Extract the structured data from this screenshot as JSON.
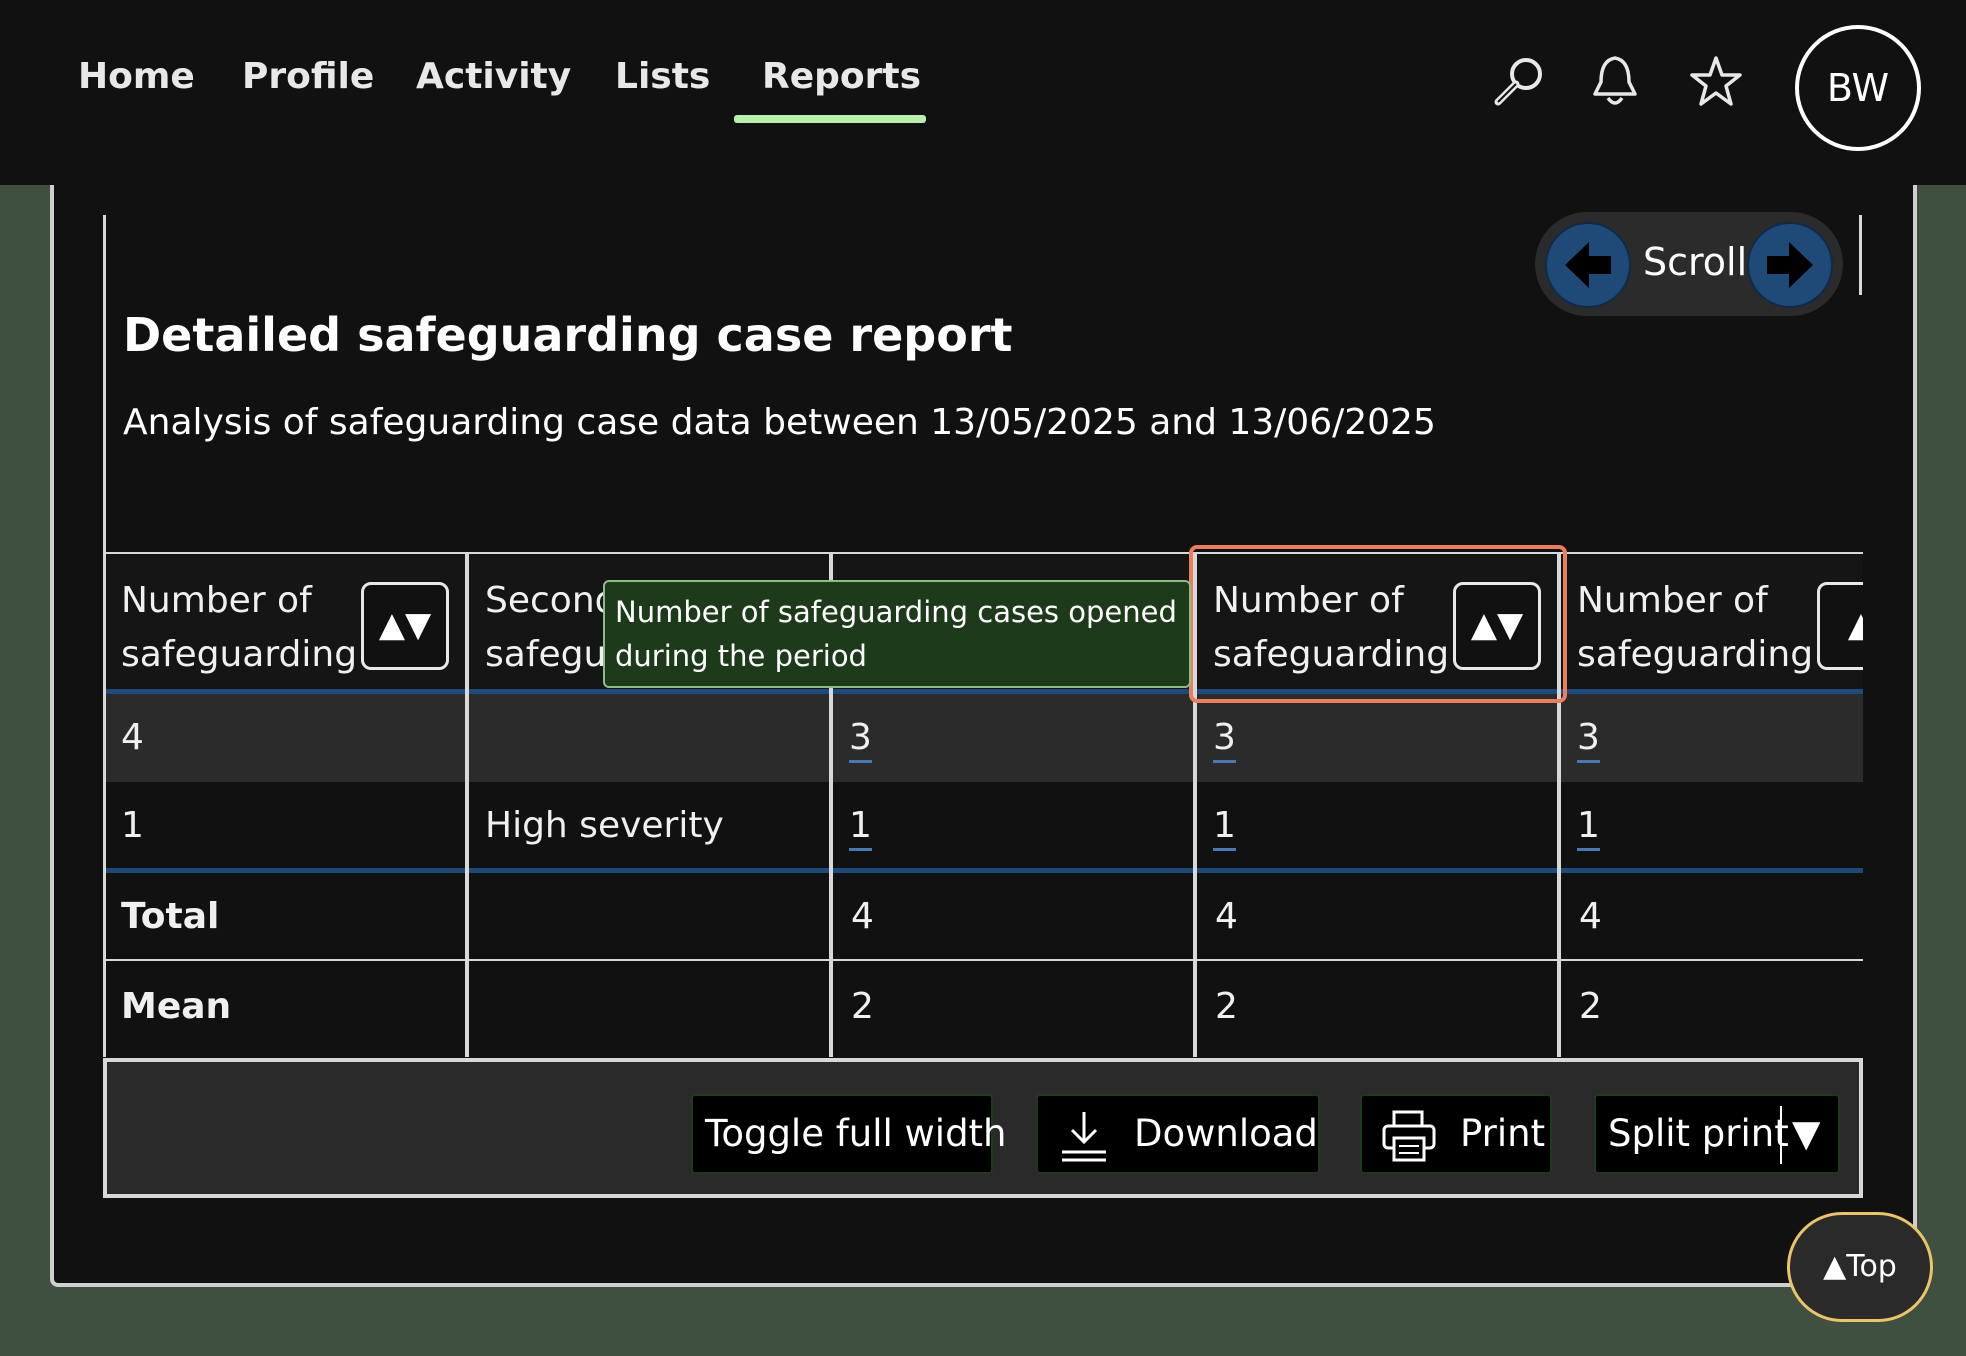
{
  "nav": {
    "items": [
      {
        "label": "Home"
      },
      {
        "label": "Profile"
      },
      {
        "label": "Activity"
      },
      {
        "label": "Lists"
      },
      {
        "label": "Reports",
        "active": true
      }
    ],
    "icons": [
      "search-icon",
      "bell-icon",
      "star-icon"
    ],
    "avatar_initials": "BW"
  },
  "scroll": {
    "label": "Scroll"
  },
  "report": {
    "title": "Detailed safeguarding case report",
    "subtitle": "Analysis of safeguarding case data between 13/05/2025 and 13/06/2025"
  },
  "table": {
    "headers": [
      {
        "text": "Number of\nsafeguarding",
        "sort": "▲▼"
      },
      {
        "text": "Second\nsafegu",
        "sort": ""
      },
      {
        "text": "",
        "sort": ""
      },
      {
        "text": "Number of\nsafeguarding",
        "sort": "▲▼"
      },
      {
        "text": "Number of\nsafeguarding",
        "sort": "▲"
      }
    ],
    "rows": [
      [
        "4",
        "",
        "3",
        "3",
        "3"
      ],
      [
        "1",
        "High severity",
        "1",
        "1",
        "1"
      ]
    ],
    "summary": [
      [
        "Total",
        "",
        "4",
        "4",
        "4"
      ],
      [
        "Mean",
        "",
        "2",
        "2",
        "2"
      ]
    ],
    "tooltip": "Number of safeguarding cases opened during the period"
  },
  "footer": {
    "toggle": "Toggle full width",
    "download": "Download",
    "print": "Print",
    "split_print": "Split print",
    "split_arrow": "▼"
  },
  "back_to_top": "▲Top",
  "colors": {
    "background": "#3f5040",
    "nav_bg": "#111111",
    "accent_underline": "#b9f0b0",
    "scroll_button": "#1f4a78",
    "focus_outline": "#e97f5f",
    "tooltip_bg": "#1d3a1a",
    "top_button_border": "#e9c46a"
  }
}
